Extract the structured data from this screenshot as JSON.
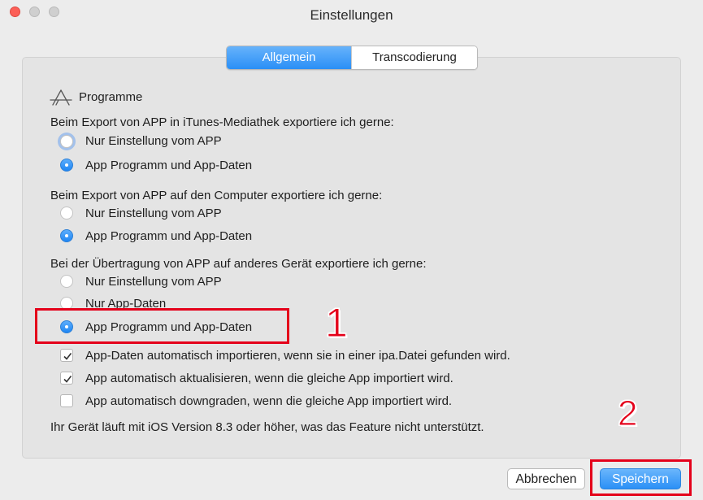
{
  "window": {
    "title": "Einstellungen",
    "close_color": "#fc5f57"
  },
  "tabs": [
    {
      "label": "Allgemein",
      "active": true
    },
    {
      "label": "Transcodierung",
      "active": false
    }
  ],
  "section": {
    "icon": "app-store-icon",
    "title": "Programme"
  },
  "groups": [
    {
      "heading": "Beim Export von APP in iTunes-Mediathek exportiere ich gerne:",
      "options": [
        {
          "label": "Nur Einstellung vom APP",
          "selected": false
        },
        {
          "label": "App Programm und App-Daten",
          "selected": true
        }
      ]
    },
    {
      "heading": "Beim Export von APP auf den Computer exportiere ich gerne:",
      "options": [
        {
          "label": "Nur Einstellung vom APP",
          "selected": false
        },
        {
          "label": "App Programm und App-Daten",
          "selected": true
        }
      ]
    },
    {
      "heading": "Bei der Übertragung von APP auf anderes Gerät exportiere ich gerne:",
      "options": [
        {
          "label": "Nur Einstellung vom APP",
          "selected": false
        },
        {
          "label": "Nur App-Daten",
          "selected": false
        },
        {
          "label": "App Programm und App-Daten",
          "selected": true
        }
      ]
    }
  ],
  "checkboxes": [
    {
      "label": "App-Daten automatisch importieren, wenn sie in einer ipa.Datei gefunden wird.",
      "checked": true
    },
    {
      "label": "App automatisch aktualisieren, wenn die gleiche App importiert wird.",
      "checked": true
    },
    {
      "label": "App automatisch downgraden, wenn die gleiche App importiert wird.",
      "checked": false
    }
  ],
  "footer_note": "Ihr Gerät läuft mit iOS Version 8.3 oder höher, was das Feature nicht unterstützt.",
  "buttons": {
    "cancel": "Abbrechen",
    "save": "Speichern"
  },
  "annotations": {
    "step1": "1",
    "step2": "2",
    "color": "#e4001a"
  },
  "accent_color": "#2a8ff6"
}
